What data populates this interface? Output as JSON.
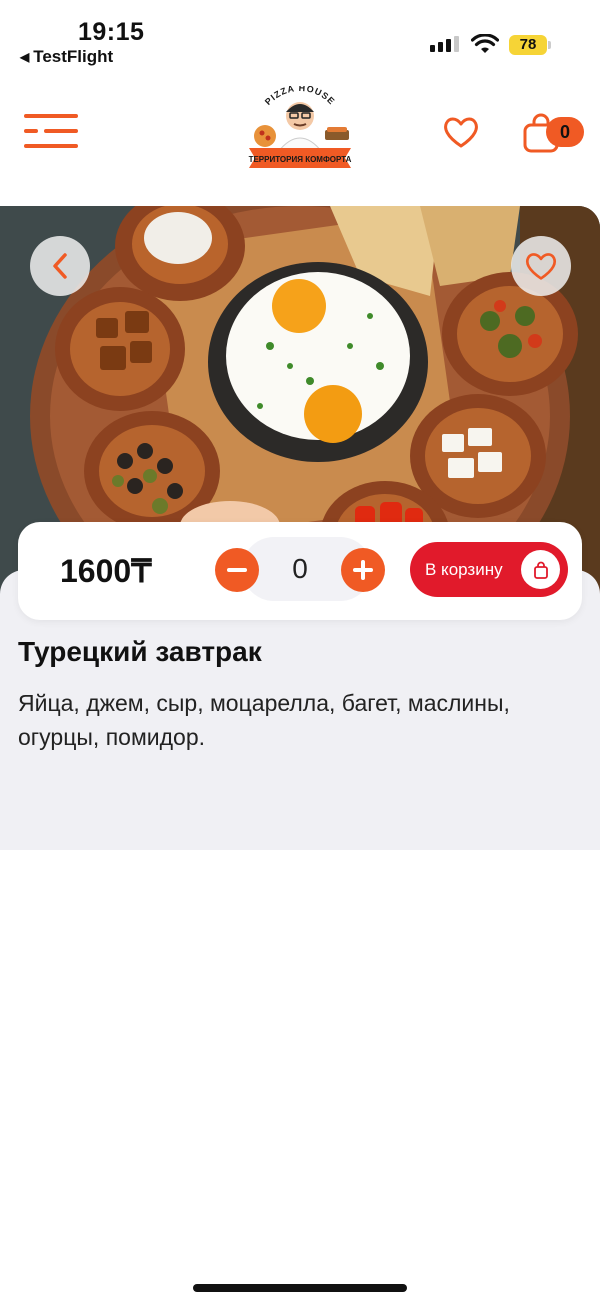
{
  "status_bar": {
    "time": "19:15",
    "back_app": "TestFlight",
    "back_icon": "back-triangle-icon",
    "battery": "78"
  },
  "header": {
    "logo": {
      "top_text": "PIZZA HOUSE",
      "ribbon_text": "ТЕРРИТОРИЯ КОМФОРТА"
    },
    "menu_icon": "hamburger-menu-icon",
    "favorites_icon": "heart-outline-icon",
    "cart_icon": "shopping-bag-icon",
    "cart_count": "0"
  },
  "product": {
    "image": "turkish-breakfast-photo",
    "prev_icon": "chevron-left-icon",
    "like_icon": "heart-outline-icon",
    "price": "1600₸",
    "quantity": "0",
    "add_to_cart": "В корзину",
    "title": "Турецкий завтрак",
    "description": "Яйца, джем, сыр, моцарелла, багет, маслины, огурцы, помидор."
  },
  "colors": {
    "accent": "#f05a24",
    "add_to_cart": "#e11a2b",
    "sheet_bg": "#f0f0f4"
  }
}
